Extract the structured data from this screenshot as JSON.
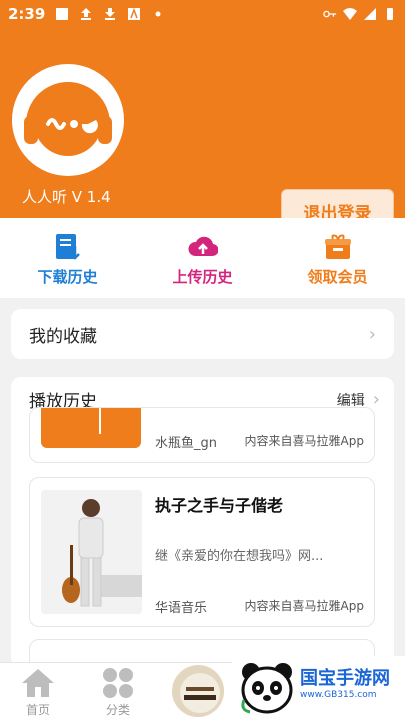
{
  "status_bar": {
    "time": "2:39"
  },
  "profile": {
    "app_version": "人人听 V 1.4",
    "logout_label": "退出登录"
  },
  "quick_actions": [
    {
      "label": "下载历史",
      "color": "#1f7fd6"
    },
    {
      "label": "上传历史",
      "color": "#d4257e"
    },
    {
      "label": "领取会员",
      "color": "#f07d1c"
    }
  ],
  "favorites": {
    "title": "我的收藏"
  },
  "history": {
    "title": "播放历史",
    "edit_label": "编辑",
    "items": [
      {
        "author": "水瓶鱼_gn",
        "source": "内容来自喜马拉雅App"
      },
      {
        "title": "执子之手与子偕老",
        "desc": "继《亲爱的你在想我吗》网...",
        "author": "华语音乐",
        "source": "内容来自喜马拉雅App"
      }
    ]
  },
  "bottom_nav": {
    "home_label": "首页",
    "category_label": "分类"
  },
  "watermark": {
    "name": "国宝手游网",
    "url": "www.GB315.com"
  },
  "colors": {
    "brand_orange": "#f07d1c",
    "download_blue": "#1f7fd6",
    "upload_pink": "#d4257e"
  }
}
